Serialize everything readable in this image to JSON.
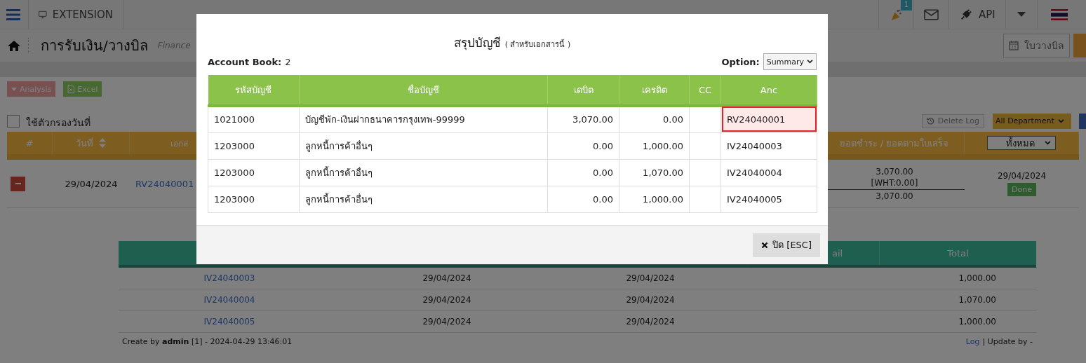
{
  "navbar": {
    "extension": "EXTENSION",
    "notification_badge": "1",
    "api": "API"
  },
  "page_header": {
    "title": "การรับเงิน/วางบิล",
    "subtitle": "Finance",
    "bill_button": "ใบวางบิล"
  },
  "actions": [
    {
      "label": "Analysis",
      "kind": "dropdown"
    },
    {
      "label": "Excel",
      "kind": "excel"
    }
  ],
  "date_filter": {
    "label": "ใช้ตัวกรองวันที่",
    "checked": false
  },
  "toolbar": {
    "delete_log": "Delete Log",
    "department": "All Department"
  },
  "list_table": {
    "columns": [
      "#",
      "วันที่",
      "เอกส",
      "ยอดชำระ / ยอดตามใบเสร็จ"
    ],
    "status_filter": "ทั้งหมด",
    "rows": [
      {
        "expanded": true,
        "date": "29/04/2024",
        "document": "RV24040001",
        "paid": "3,070.00",
        "wht": "[WHT:0.00]",
        "receipt_total": "3,070.00",
        "status_date": "29/04/2024",
        "status": "Done"
      }
    ]
  },
  "detail_table": {
    "columns": [
      "ail",
      "Total"
    ],
    "rows": [
      {
        "document": "IV24040003",
        "date_1": "29/04/2024",
        "date_2": "29/04/2024",
        "total": "1,000.00"
      },
      {
        "document": "IV24040004",
        "date_1": "29/04/2024",
        "date_2": "29/04/2024",
        "total": "1,070.00"
      },
      {
        "document": "IV24040005",
        "date_1": "29/04/2024",
        "date_2": "29/04/2024",
        "total": "1,000.00"
      }
    ],
    "footer": {
      "created": "Create by **admin** [1] - 2024-04-29 13:46:01",
      "log": "Log",
      "updated": "| Update by -"
    }
  },
  "modal": {
    "title": "สรุปบัญชี",
    "title_note": "( สำหรับเอกสารนี้ )",
    "account_book_label": "Account Book:",
    "account_book": "2",
    "option_label": "Option:",
    "option": "Summary",
    "columns": [
      "รหัสบัญชี",
      "ชื่อบัญชี",
      "เดบิต",
      "เครดิต",
      "CC",
      "Anc"
    ],
    "rows": [
      {
        "code": "1021000",
        "name": "บัญชีพัก-เงินฝากธนาคารกรุงเทพ-99999",
        "debit": "3,070.00",
        "credit": "0.00",
        "anc": "RV24040001",
        "highlighted": true
      },
      {
        "code": "1203000",
        "name": "ลูกหนี้การค้าอื่นๆ",
        "debit": "0.00",
        "credit": "1,000.00",
        "anc": "IV24040003",
        "highlighted": false
      },
      {
        "code": "1203000",
        "name": "ลูกหนี้การค้าอื่นๆ",
        "debit": "0.00",
        "credit": "1,070.00",
        "anc": "IV24040004",
        "highlighted": false
      },
      {
        "code": "1203000",
        "name": "ลูกหนี้การค้าอื่นๆ",
        "debit": "0.00",
        "credit": "1,000.00",
        "anc": "IV24040005",
        "highlighted": false
      }
    ],
    "close_button": "ปิด [ESC]"
  }
}
